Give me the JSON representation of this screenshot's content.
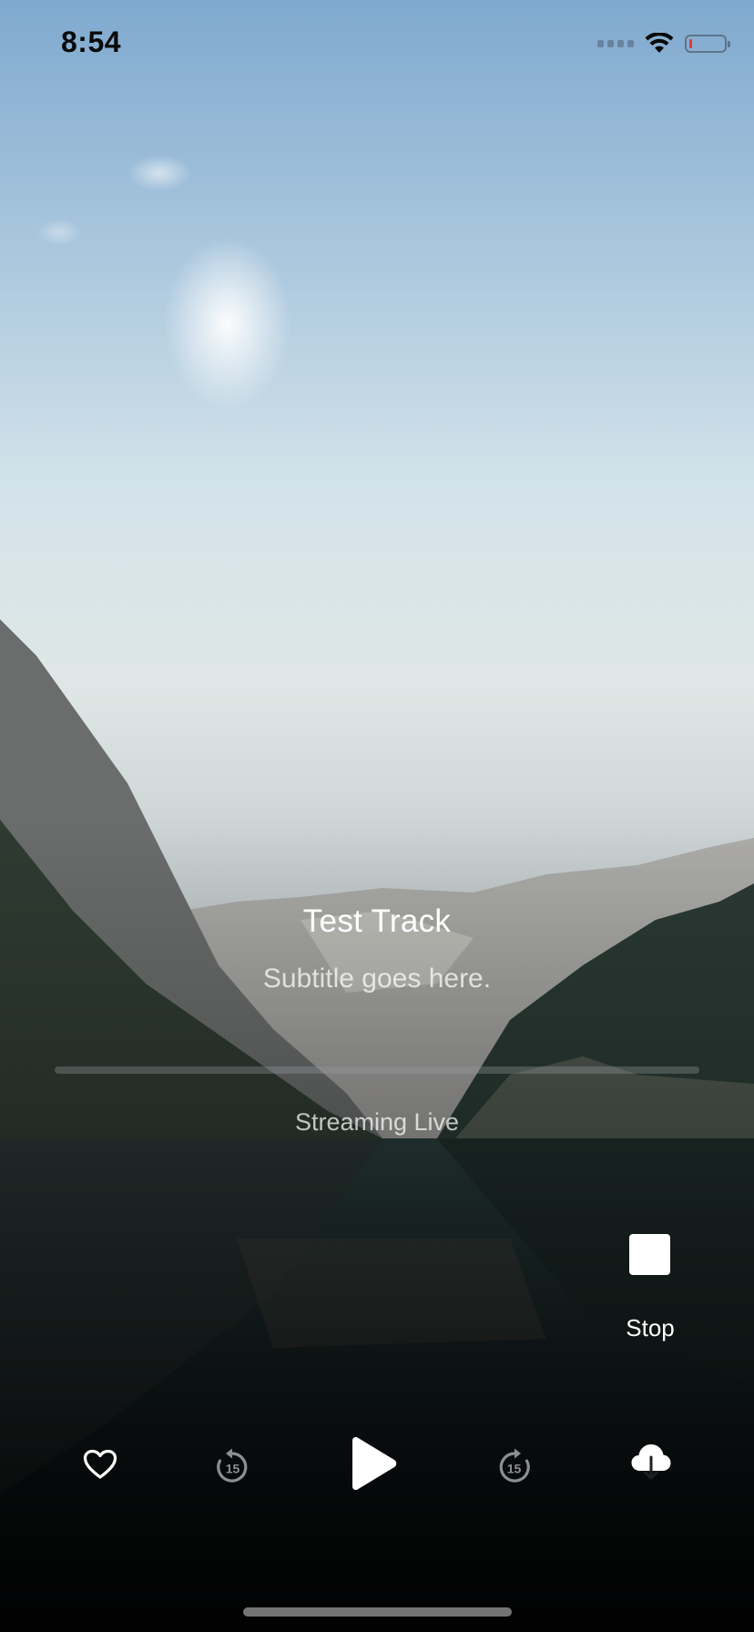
{
  "status_bar": {
    "time": "8:54",
    "battery_color": "#e53935"
  },
  "player": {
    "title": "Test Track",
    "subtitle": "Subtitle goes here.",
    "stream_status": "Streaming Live",
    "progress_fraction": 0,
    "stop_label": "Stop"
  },
  "controls": [
    {
      "name": "favorite",
      "icon": "heart-outline-icon"
    },
    {
      "name": "rewind-15",
      "icon": "replay-15-icon",
      "label": "15"
    },
    {
      "name": "play",
      "icon": "play-icon"
    },
    {
      "name": "forward-15",
      "icon": "forward-15-icon",
      "label": "15"
    },
    {
      "name": "download",
      "icon": "cloud-download-icon"
    }
  ],
  "colors": {
    "primary_text": "#ffffff",
    "secondary_text": "#c8cdd2",
    "disabled_icon": "#8a8f94"
  }
}
